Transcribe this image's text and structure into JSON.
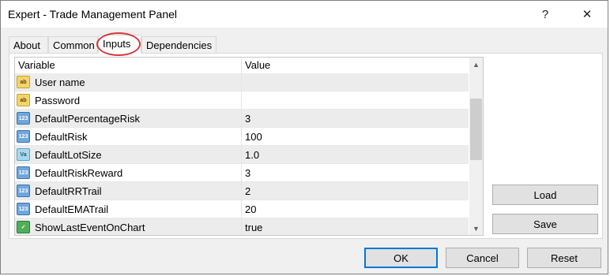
{
  "window": {
    "title": "Expert - Trade Management Panel",
    "help_glyph": "?",
    "close_glyph": "✕"
  },
  "tabs": [
    {
      "label": "About",
      "selected": false
    },
    {
      "label": "Common",
      "selected": false
    },
    {
      "label": "Inputs",
      "selected": true
    },
    {
      "label": "Dependencies",
      "selected": false
    }
  ],
  "grid": {
    "headers": {
      "variable": "Variable",
      "value": "Value"
    },
    "rows": [
      {
        "icon": "string-type-icon",
        "glyph": "ab",
        "name": "User name",
        "value": ""
      },
      {
        "icon": "string-type-icon",
        "glyph": "ab",
        "name": "Password",
        "value": ""
      },
      {
        "icon": "integer-type-icon",
        "glyph": "123",
        "name": "DefaultPercentageRisk",
        "value": "3"
      },
      {
        "icon": "integer-type-icon",
        "glyph": "123",
        "name": "DefaultRisk",
        "value": "100"
      },
      {
        "icon": "double-type-icon",
        "glyph": "Va",
        "name": "DefaultLotSize",
        "value": "1.0"
      },
      {
        "icon": "integer-type-icon",
        "glyph": "123",
        "name": "DefaultRiskReward",
        "value": "3"
      },
      {
        "icon": "integer-type-icon",
        "glyph": "123",
        "name": "DefaultRRTrail",
        "value": "2"
      },
      {
        "icon": "integer-type-icon",
        "glyph": "123",
        "name": "DefaultEMATrail",
        "value": "20"
      },
      {
        "icon": "bool-type-icon",
        "glyph": "✓",
        "name": "ShowLastEventOnChart",
        "value": "true"
      }
    ]
  },
  "side_buttons": {
    "load": "Load",
    "save": "Save"
  },
  "footer_buttons": {
    "ok": "OK",
    "cancel": "Cancel",
    "reset": "Reset"
  },
  "colors": {
    "highlight_ellipse": "#d9363a",
    "default_button_border": "#0078d7"
  }
}
